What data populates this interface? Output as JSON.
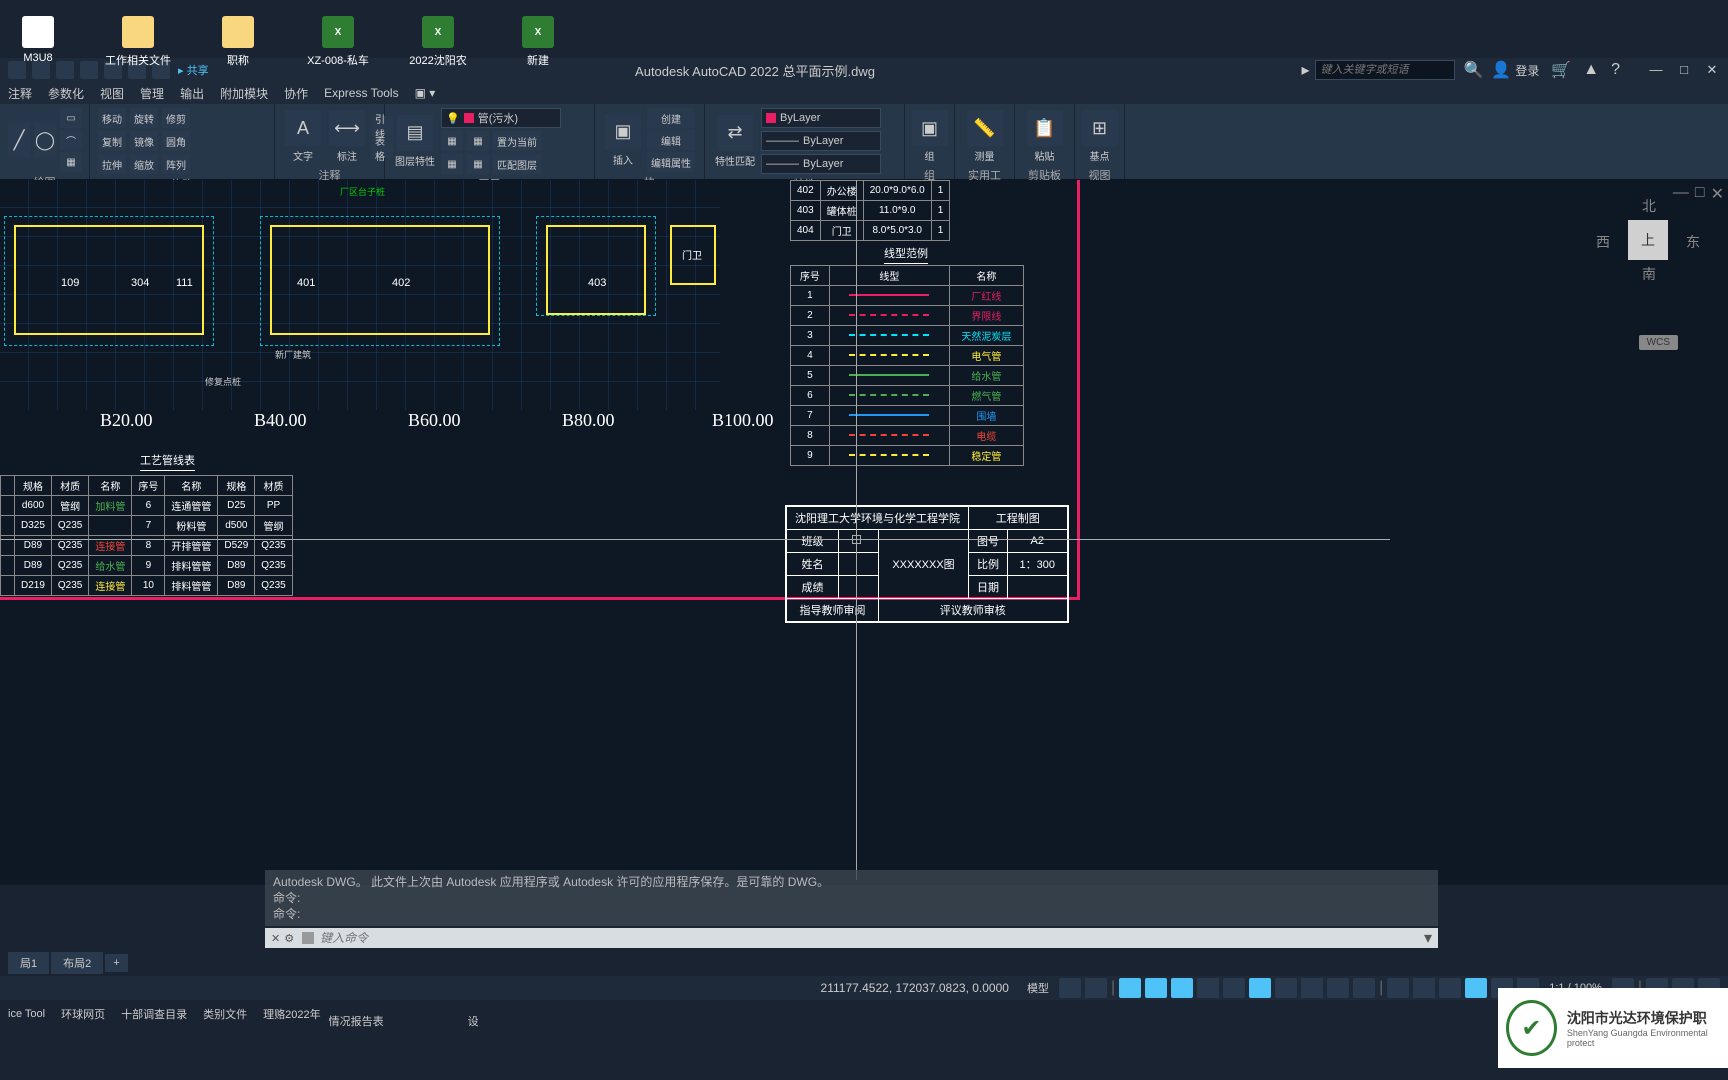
{
  "desktop": [
    {
      "label": "M3U8",
      "type": "txt"
    },
    {
      "label": "工作相关文件",
      "type": "folder"
    },
    {
      "label": "职称",
      "type": "folder"
    },
    {
      "label": "XZ-008-私车",
      "type": "excel"
    },
    {
      "label": "2022沈阳农",
      "type": "excel"
    },
    {
      "label": "新建",
      "type": "excel"
    }
  ],
  "app": {
    "title": "Autodesk AutoCAD 2022   总平面示例.dwg",
    "share": "共享",
    "search_placeholder": "键入关键字或短语",
    "login": "登录"
  },
  "menu": [
    "注释",
    "参数化",
    "视图",
    "管理",
    "输出",
    "附加模块",
    "协作",
    "Express Tools"
  ],
  "ribbon": {
    "draw_label": "绘图",
    "modify": {
      "label": "修改",
      "items": [
        "移动",
        "旋转",
        "修剪",
        "复制",
        "镜像",
        "圆角",
        "拉伸",
        "缩放",
        "阵列"
      ]
    },
    "annotate": {
      "label": "注释",
      "text": "文字",
      "dim": "标注",
      "leader": "引线",
      "table": "表格"
    },
    "layer": {
      "label": "图层",
      "props": "图层特性",
      "current": "管(污水)",
      "bylayer": "ByLayer",
      "flyout": "置为当前",
      "match": "匹配图层"
    },
    "block": {
      "label": "块",
      "insert": "插入",
      "create": "创建",
      "edit": "编辑",
      "attr": "编辑属性"
    },
    "props": {
      "label": "特性",
      "match": "特性匹配"
    },
    "group": {
      "label": "组",
      "btn": "组"
    },
    "utils": {
      "label": "实用工具",
      "measure": "测量"
    },
    "clipboard": {
      "label": "剪贴板",
      "paste": "粘贴"
    },
    "view": {
      "label": "视图",
      "base": "基点"
    }
  },
  "axis": {
    "b20": "B20.00",
    "b40": "B40.00",
    "b60": "B60.00",
    "b80": "B80.00",
    "b100": "B100.00"
  },
  "rooms": {
    "r109": "109",
    "r304": "304",
    "r111": "111",
    "r401": "401",
    "r402": "402",
    "r403": "403",
    "r门卫": "门卫"
  },
  "annotations": {
    "label1": "厂区台子桩",
    "label2": "新厂建筑",
    "label3": "修复点桩"
  },
  "upper_table": {
    "rows": [
      {
        "id": "402",
        "name": "办公楼",
        "dim": "20.0*9.0*6.0",
        "qty": "1"
      },
      {
        "id": "403",
        "name": "罐体桩",
        "dim": "11.0*9.0",
        "qty": "1"
      },
      {
        "id": "404",
        "name": "门卫",
        "dim": "8.0*5.0*3.0",
        "qty": "1"
      }
    ]
  },
  "legend": {
    "title": "线型范例",
    "headers": [
      "序号",
      "线型",
      "名称"
    ],
    "rows": [
      {
        "n": "1",
        "name": "厂红线",
        "color": "#e91e63",
        "style": "solid"
      },
      {
        "n": "2",
        "name": "界限线",
        "color": "#e91e63",
        "style": "dashed"
      },
      {
        "n": "3",
        "name": "天然泥炭层",
        "color": "#00e5ff",
        "style": "dashed"
      },
      {
        "n": "4",
        "name": "电气管",
        "color": "#ffeb3b",
        "style": "dashed"
      },
      {
        "n": "5",
        "name": "给水管",
        "color": "#4caf50",
        "style": "solid"
      },
      {
        "n": "6",
        "name": "燃气管",
        "color": "#4caf50",
        "style": "dashed"
      },
      {
        "n": "7",
        "name": "围墙",
        "color": "#2196f3",
        "style": "solid"
      },
      {
        "n": "8",
        "name": "电缆",
        "color": "#f44336",
        "style": "dashed"
      },
      {
        "n": "9",
        "name": "稳定管",
        "color": "#ffeb3b",
        "style": "dashed"
      }
    ]
  },
  "process_table": {
    "title": "工艺管线表",
    "headers": [
      "",
      "规格",
      "材质",
      "名称",
      "序号",
      "名称",
      "规格",
      "材质"
    ],
    "rows": [
      [
        "",
        "d600",
        "管纲",
        "加料管",
        "6",
        "连通管管",
        "D25",
        "PP"
      ],
      [
        "",
        "D325",
        "Q235",
        "",
        "7",
        "粉料管",
        "d500",
        "管纲"
      ],
      [
        "",
        "D89",
        "Q235",
        "连接管",
        "8",
        "开排管管",
        "D529",
        "Q235"
      ],
      [
        "",
        "D89",
        "Q235",
        "给水管",
        "9",
        "排料管管",
        "D89",
        "Q235"
      ],
      [
        "",
        "D219",
        "Q235",
        "连接管",
        "10",
        "排料管管",
        "D89",
        "Q235"
      ]
    ]
  },
  "title_block": {
    "school": "沈阳理工大学环境与化学工程学院",
    "project": "工程制图",
    "class_label": "班级",
    "class_val": "",
    "drawing_no_label": "图号",
    "drawing_no": "A2",
    "name_label": "姓名",
    "name_val": "XXXXXXX图",
    "scale_label": "比例",
    "scale_val": "1：300",
    "grade_label": "成绩",
    "date_label": "日期",
    "advisor_label": "指导教师审阅",
    "reviewer_label": "评议教师审核"
  },
  "viewcube": {
    "top": "上",
    "n": "北",
    "s": "南",
    "e": "东",
    "w": "西",
    "wcs": "WCS"
  },
  "cmd": {
    "history1": "Autodesk DWG。 此文件上次由 Autodesk 应用程序或 Autodesk 许可的应用程序保存。是可靠的 DWG。",
    "history2": "命令:",
    "history3": "命令:",
    "placeholder": "键入命令"
  },
  "tabs": {
    "t1": "局1",
    "t2": "布局2",
    "plus": "+"
  },
  "status": {
    "coords": "211177.4522, 172037.0823, 0.0000",
    "model": "模型",
    "scale": "1:1 / 100%"
  },
  "taskbar": [
    "ice Tool",
    "环球网页",
    "十部调查目录",
    "类别文件",
    "理赂2022年",
    "情况报告表",
    "设"
  ],
  "watermark": {
    "line1": "沈阳市光达环境保护职",
    "line2": "ShenYang Guangda Environmental protect"
  }
}
